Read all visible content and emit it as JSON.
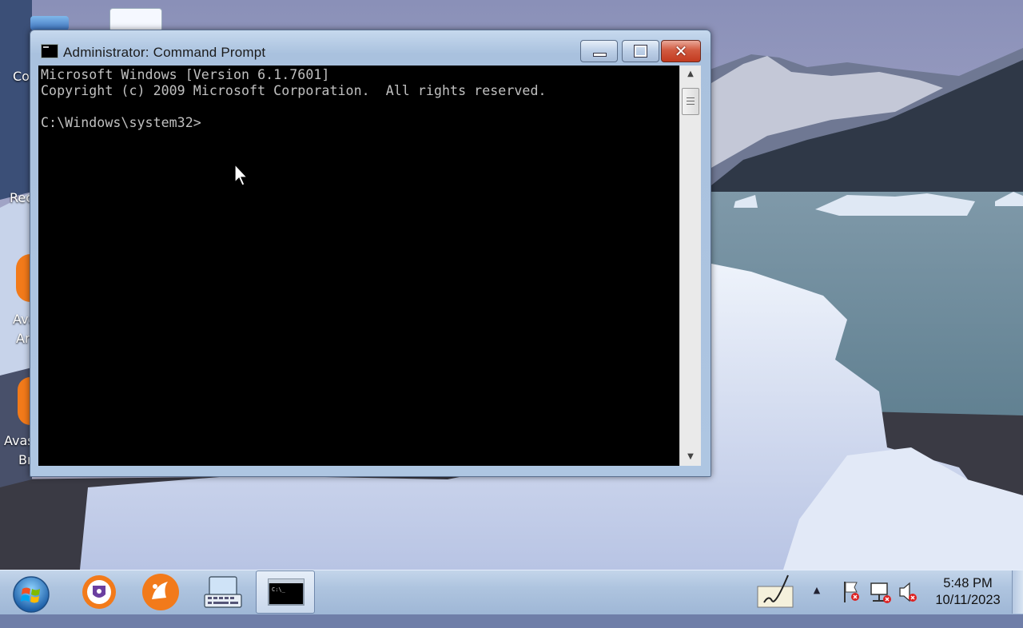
{
  "window": {
    "title": "Administrator:  Command Prompt",
    "buttons": {
      "minimize": "minimize",
      "maximize": "maximize",
      "close": "✕"
    }
  },
  "console": {
    "lines": [
      "Microsoft Windows [Version 6.1.7601]",
      "Copyright (c) 2009 Microsoft Corporation.  All rights reserved.",
      "",
      "C:\\Windows\\system32>"
    ]
  },
  "desktop": {
    "icon_labels": [
      "Co",
      "Rec",
      "Ava",
      "Ar",
      "Avas",
      "Br"
    ]
  },
  "taskbar": {
    "items": [
      {
        "name": "start-button",
        "icon": "windows-orb-icon"
      },
      {
        "name": "avast-secure-browser",
        "icon": "avast-browser-icon"
      },
      {
        "name": "avast-antivirus",
        "icon": "avast-icon"
      },
      {
        "name": "on-screen-keyboard",
        "icon": "keyboard-icon"
      },
      {
        "name": "command-prompt",
        "icon": "cmd-icon",
        "active": true
      }
    ],
    "tray": {
      "icons": [
        "pen-input-icon",
        "show-hidden-icons-arrow",
        "action-center-flag-icon",
        "network-icon",
        "volume-muted-icon"
      ],
      "time": "5:48 PM",
      "date": "10/11/2023"
    }
  },
  "colors": {
    "console_bg": "#000000",
    "console_text": "#c0c0c0",
    "close_button": "#c9452a",
    "taskbar": "#b0c6e0"
  }
}
